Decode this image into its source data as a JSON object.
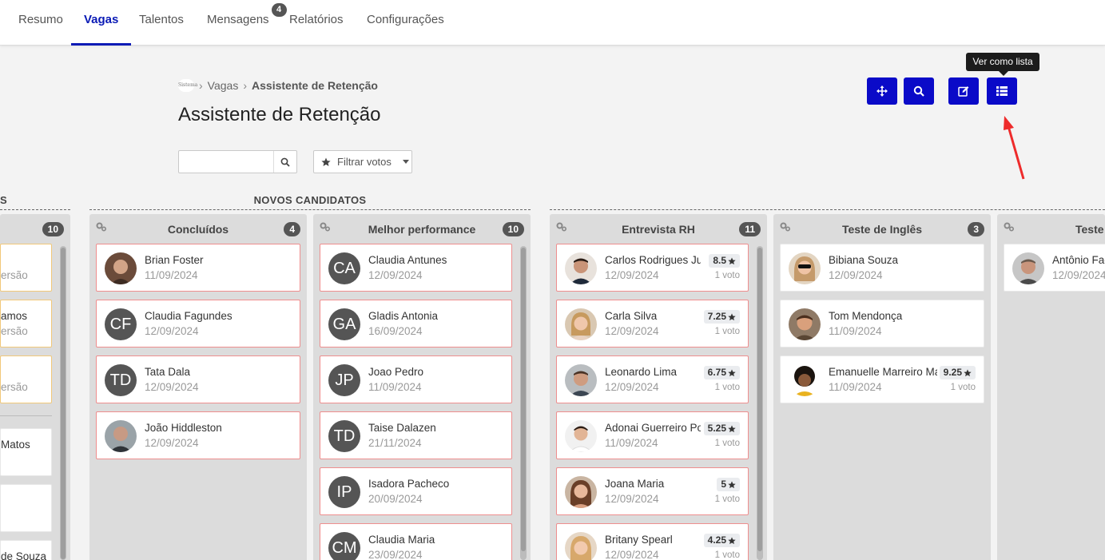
{
  "nav": {
    "tabs": [
      {
        "label": "Resumo"
      },
      {
        "label": "Vagas"
      },
      {
        "label": "Talentos"
      },
      {
        "label": "Mensagens",
        "badge": "4"
      },
      {
        "label": "Relatórios"
      },
      {
        "label": "Configurações"
      }
    ],
    "active_tab": "Vagas"
  },
  "breadcrumb": {
    "logo_text": "Sistema",
    "vagas": "Vagas",
    "current": "Assistente de Retenção"
  },
  "page_title": "Assistente de Retenção",
  "search": {
    "placeholder": ""
  },
  "filter_label": "Filtrar votos",
  "tooltip": "Ver como lista",
  "accent_color": "#0a0ac8",
  "groups": {
    "left_partial_label": "S",
    "novos_candidatos": "NOVOS CANDIDATOS"
  },
  "left_partial_column": {
    "count": "10",
    "cards": [
      {
        "name": "",
        "sub": "ersão"
      },
      {
        "name": "amos",
        "sub": "ersão"
      },
      {
        "name": "",
        "sub": "ersão"
      },
      {
        "name": "Matos",
        "sub": ""
      },
      {
        "name": "",
        "sub": ""
      },
      {
        "name": "de Souza",
        "sub": ""
      }
    ]
  },
  "columns": [
    {
      "title": "Concluídos",
      "count": "4",
      "cards": [
        {
          "name": "Brian Foster",
          "date": "11/09/2024",
          "avatar": "photo"
        },
        {
          "name": "Claudia Fagundes",
          "date": "12/09/2024",
          "initials": "CF"
        },
        {
          "name": "Tata Dala",
          "date": "12/09/2024",
          "initials": "TD"
        },
        {
          "name": "João Hiddleston",
          "date": "12/09/2024",
          "avatar": "photo"
        }
      ]
    },
    {
      "title": "Melhor performance",
      "count": "10",
      "cards": [
        {
          "name": "Claudia Antunes",
          "date": "12/09/2024",
          "initials": "CA"
        },
        {
          "name": "Gladis Antonia",
          "date": "16/09/2024",
          "initials": "GA"
        },
        {
          "name": "Joao Pedro",
          "date": "11/09/2024",
          "initials": "JP"
        },
        {
          "name": "Taise Dalazen",
          "date": "21/11/2024",
          "initials": "TD"
        },
        {
          "name": "Isadora Pacheco",
          "date": "20/09/2024",
          "initials": "IP"
        },
        {
          "name": "Claudia Maria",
          "date": "23/09/2024",
          "initials": "CM"
        }
      ]
    },
    {
      "title": "Entrevista RH",
      "count": "11",
      "cards": [
        {
          "name": "Carlos Rodrigues Junior",
          "date": "12/09/2024",
          "score": "8.5",
          "votes": "1 voto",
          "avatar": "photo"
        },
        {
          "name": "Carla Silva",
          "date": "12/09/2024",
          "score": "7.25",
          "votes": "1 voto",
          "avatar": "photo"
        },
        {
          "name": "Leonardo Lima",
          "date": "12/09/2024",
          "score": "6.75",
          "votes": "1 voto",
          "avatar": "photo"
        },
        {
          "name": "Adonai Guerreiro Porto",
          "date": "11/09/2024",
          "score": "5.25",
          "votes": "1 voto",
          "avatar": "photo"
        },
        {
          "name": "Joana Maria",
          "date": "12/09/2024",
          "score": "5",
          "votes": "1 voto",
          "avatar": "photo"
        },
        {
          "name": "Britany Spearl",
          "date": "12/09/2024",
          "score": "4.25",
          "votes": "1 voto",
          "avatar": "photo"
        }
      ]
    },
    {
      "title": "Teste de Inglês",
      "count": "3",
      "cards": [
        {
          "name": "Bibiana Souza",
          "date": "12/09/2024",
          "avatar": "photo"
        },
        {
          "name": "Tom Mendonça",
          "date": "11/09/2024",
          "avatar": "photo"
        },
        {
          "name": "Emanuelle Marreiro Matos",
          "date": "11/09/2024",
          "score": "9.25",
          "votes": "1 voto",
          "avatar": "photo"
        }
      ]
    },
    {
      "title": "Teste",
      "count": "",
      "cards": [
        {
          "name": "Antônio Fagundes",
          "date": "12/09/2024",
          "avatar": "photo"
        }
      ]
    }
  ]
}
